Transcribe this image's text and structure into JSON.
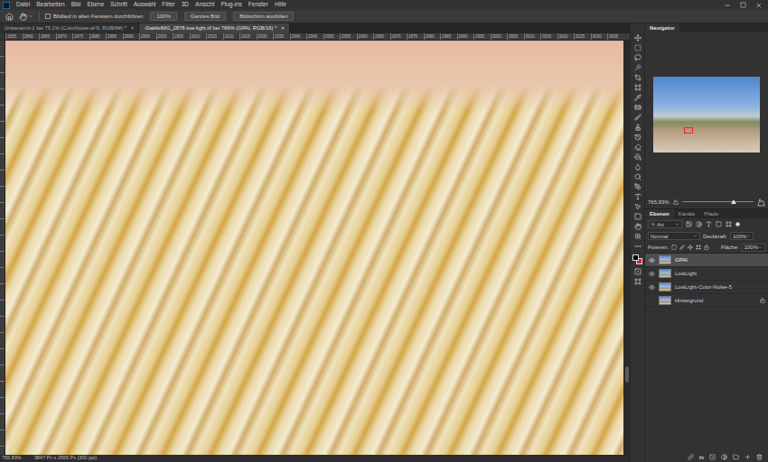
{
  "menu": [
    "Datei",
    "Bearbeiten",
    "Bild",
    "Ebene",
    "Schrift",
    "Auswahl",
    "Filter",
    "3D",
    "Ansicht",
    "Plug-ins",
    "Fenster",
    "Hilfe"
  ],
  "options_bar": {
    "scroll_all": {
      "label": "Bildlauf in allen Fenstern durchführen",
      "checked": false
    },
    "buttons": [
      "100%",
      "Ganzes Bild",
      "Bildschirm ausfüllen"
    ]
  },
  "tabs": [
    {
      "label": "Unbenannt-1 bei 75,1% (ColorNoise-af-5, RGB/8#) *",
      "close": "×",
      "selected": false
    },
    {
      "label": "-StableIMG_2878-low-light.tif bei 766% (GPAI, RGB/16) *",
      "close": "×",
      "selected": true
    }
  ],
  "ruler": {
    "labels": [
      "2855",
      "2860",
      "2865",
      "2870",
      "2875",
      "2880",
      "2885",
      "2890",
      "2895",
      "2900",
      "2905",
      "2910",
      "2915",
      "2920",
      "2925",
      "2930",
      "2935",
      "2940",
      "2945",
      "2950",
      "2955",
      "2960",
      "2965",
      "2970",
      "2975",
      "2980",
      "2985",
      "2990",
      "2995",
      "3000",
      "3005",
      "3010",
      "3015",
      "3020",
      "3025",
      "3030",
      "3035"
    ]
  },
  "navigator": {
    "title": "Navigator",
    "zoom": "765,83%",
    "level": 0.72
  },
  "layers_panel": {
    "tabs": [
      {
        "label": "Ebenen",
        "selected": true
      },
      {
        "label": "Kanäle",
        "selected": false
      },
      {
        "label": "Pfade",
        "selected": false
      }
    ],
    "filter": "Art",
    "blend_mode": "Normal",
    "opacity_label": "Deckkraft:",
    "opacity": "100%",
    "lock_label": "Fixieren:",
    "fill_label": "Fläche:",
    "fill": "100%",
    "layers": [
      {
        "name": "GPAI",
        "selected": true,
        "visible": true,
        "locked": false
      },
      {
        "name": "LowLight",
        "selected": false,
        "visible": true,
        "locked": false
      },
      {
        "name": "LowLight-Color-Noise-5",
        "selected": false,
        "visible": true,
        "locked": false
      },
      {
        "name": "Hintergrund",
        "selected": false,
        "visible": false,
        "locked": true
      }
    ],
    "fx": "fx"
  },
  "status_bar": {
    "zoom": "765,83%",
    "info": "3847 Px x 2565 Px (300 ppi)"
  }
}
